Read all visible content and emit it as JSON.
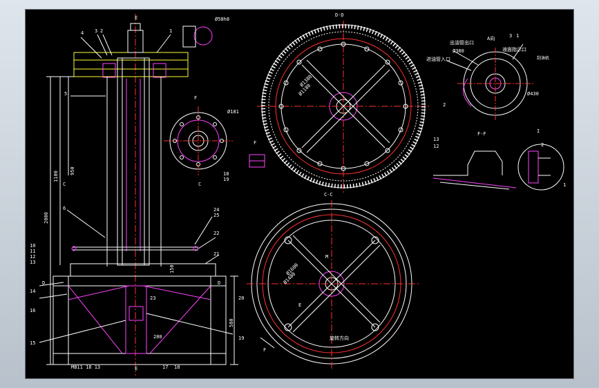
{
  "colors": {
    "background": "#000000",
    "outline": "#ffffff",
    "centerline": "#ff3030",
    "hatch": "#ff44ff",
    "dimension": "#ffffff",
    "highlight": "#ffff33",
    "cyan": "#33e0ff"
  },
  "left_view": {
    "part_numbers": [
      "4",
      "3",
      "2",
      "1",
      "5",
      "6",
      "10",
      "11",
      "12",
      "13",
      "14",
      "15",
      "16",
      "17",
      "18",
      "19",
      "20",
      "21",
      "22",
      "23",
      "24",
      "25"
    ],
    "dims": [
      "1100",
      "950",
      "2000",
      "580",
      "150",
      "280"
    ],
    "section_marks": [
      "C",
      "C",
      "D",
      "D",
      "E",
      "E"
    ],
    "bottom_label": "MB11 18 13"
  },
  "detail_hub": {
    "dim": "Ø181",
    "marks": [
      "F",
      "F"
    ],
    "parts": [
      "18",
      "19"
    ]
  },
  "detail_top_shaft": {
    "dim": "Ø58h8"
  },
  "view_dd": {
    "title": "D-D",
    "inner_dims": [
      "Ø1380",
      "Ø1180"
    ]
  },
  "view_cc": {
    "title": "C-C",
    "inner_dims": [
      "Ø1600",
      "Ø1480"
    ],
    "rotation_label": "旋转方向",
    "marks": [
      "E",
      "F",
      "M"
    ]
  },
  "detail_right": {
    "labels": [
      "出油管出口",
      "A向",
      "进油管入口",
      "液面指示口",
      "刮油机"
    ],
    "dims": [
      "Ø380",
      "Ø430"
    ],
    "parts": [
      "2",
      "3",
      "1"
    ]
  },
  "detail_ff": {
    "title": "F-F",
    "parts": [
      "13",
      "12"
    ]
  },
  "detail_k": {
    "title": "I",
    "parts": [
      "1",
      "2"
    ]
  }
}
